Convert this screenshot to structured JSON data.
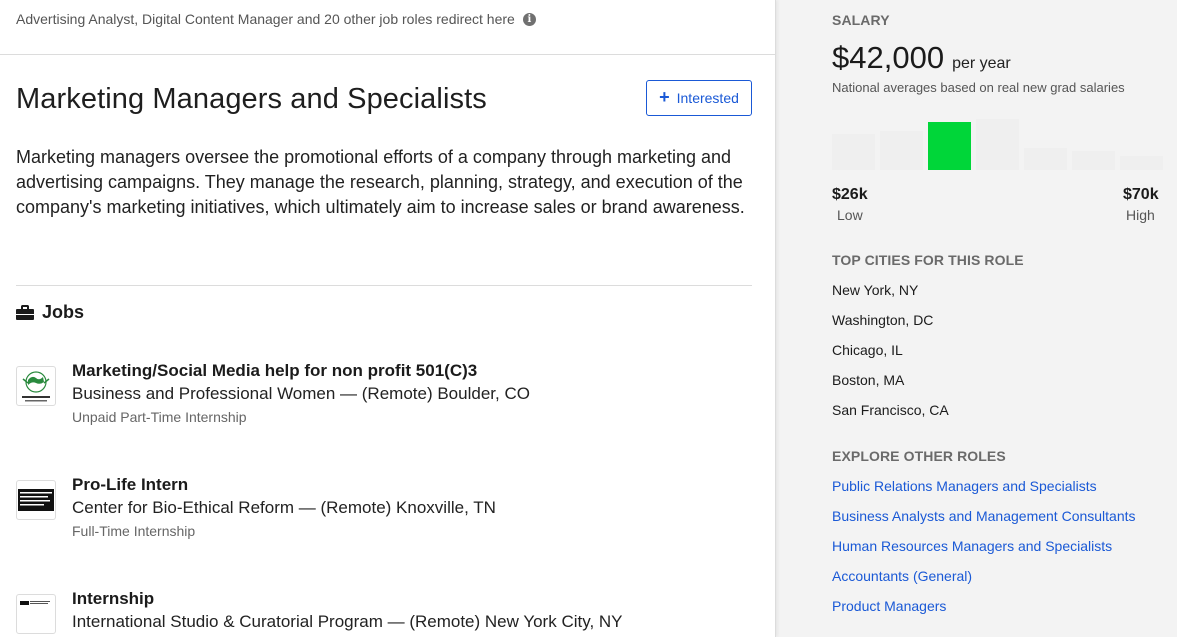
{
  "redirect_note": "Advertising Analyst, Digital Content Manager and 20 other job roles redirect here",
  "role": {
    "title": "Marketing Managers and Specialists",
    "interested_label": "Interested",
    "description": "Marketing managers oversee the promotional efforts of a company through marketing and advertising campaigns. They manage the research, planning, strategy, and execution of the company's marketing initiatives, which ultimately aim to increase sales or brand awareness."
  },
  "jobs": {
    "heading": "Jobs",
    "items": [
      {
        "title": "Marketing/Social Media help for non profit 501(C)3",
        "employer": "Business and Professional Women — (Remote) Boulder, CO",
        "type": "Unpaid Part-Time Internship",
        "logo": "bpw-globe-logo"
      },
      {
        "title": "Pro-Life Intern",
        "employer": "Center for Bio-Ethical Reform — (Remote) Knoxville, TN",
        "type": "Full-Time Internship",
        "logo": "cbr-logo"
      },
      {
        "title": "Internship",
        "employer": "International Studio & Curatorial Program — (Remote) New York City, NY",
        "type": "",
        "logo": "iscp-logo"
      }
    ]
  },
  "salary": {
    "label": "SALARY",
    "amount": "$42,000",
    "unit": "per year",
    "note": "National averages based on real new grad salaries",
    "low_value": "$26k",
    "low_caption": "Low",
    "high_value": "$70k",
    "high_caption": "High",
    "histogram_levels": [
      0.6,
      0.65,
      0.8,
      0.85,
      0.36,
      0.31,
      0.23
    ],
    "active_bar_index": 2,
    "colors": {
      "active": "#00d639",
      "inactive": "#efefef"
    }
  },
  "top_cities": {
    "label": "TOP CITIES FOR THIS ROLE",
    "items": [
      "New York, NY",
      "Washington, DC",
      "Chicago, IL",
      "Boston, MA",
      "San Francisco, CA"
    ]
  },
  "other_roles": {
    "label": "EXPLORE OTHER ROLES",
    "items": [
      "Public Relations Managers and Specialists",
      "Business Analysts and Management Consultants",
      "Human Resources Managers and Specialists",
      "Accountants (General)",
      "Product Managers"
    ]
  },
  "colors": {
    "link": "#1a59d6",
    "accent_green": "#00d639"
  }
}
